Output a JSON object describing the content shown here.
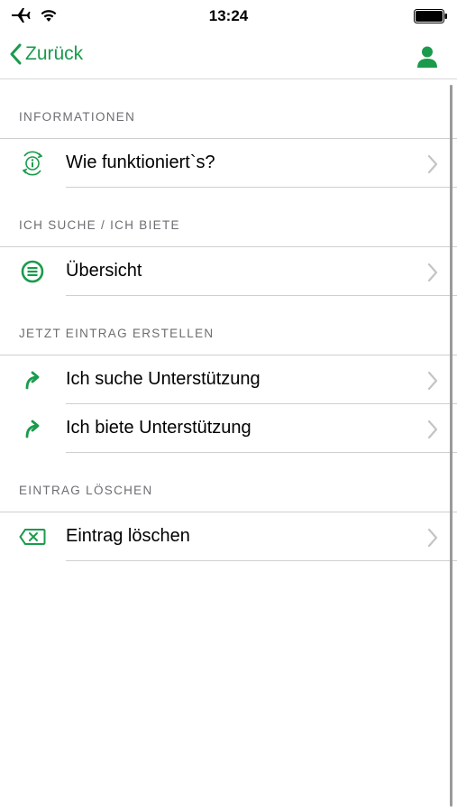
{
  "status_bar": {
    "time": "13:24",
    "icons": [
      "airplane-icon",
      "wifi-icon",
      "battery-icon"
    ]
  },
  "nav": {
    "back_label": "Zurück",
    "icons": [
      "chevron-left-icon",
      "person-icon"
    ]
  },
  "colors": {
    "accent": "#1a9b4c",
    "section_text": "#6d6d72",
    "separator": "#cfcfcf"
  },
  "sections": [
    {
      "header": "INFORMATIONEN",
      "items": [
        {
          "label": "Wie funktioniert`s?",
          "icon": "info-cycle-icon"
        }
      ]
    },
    {
      "header": "ICH SUCHE / ICH BIETE",
      "items": [
        {
          "label": "Übersicht",
          "icon": "list-circle-icon"
        }
      ]
    },
    {
      "header": "JETZT EINTRAG ERSTELLEN",
      "items": [
        {
          "label": "Ich suche Unterstützung",
          "icon": "forward-arrow-icon"
        },
        {
          "label": "Ich biete Unterstützung",
          "icon": "forward-arrow-icon"
        }
      ]
    },
    {
      "header": "EINTRAG LÖSCHEN",
      "items": [
        {
          "label": "Eintrag löschen",
          "icon": "delete-tag-icon"
        }
      ]
    }
  ]
}
